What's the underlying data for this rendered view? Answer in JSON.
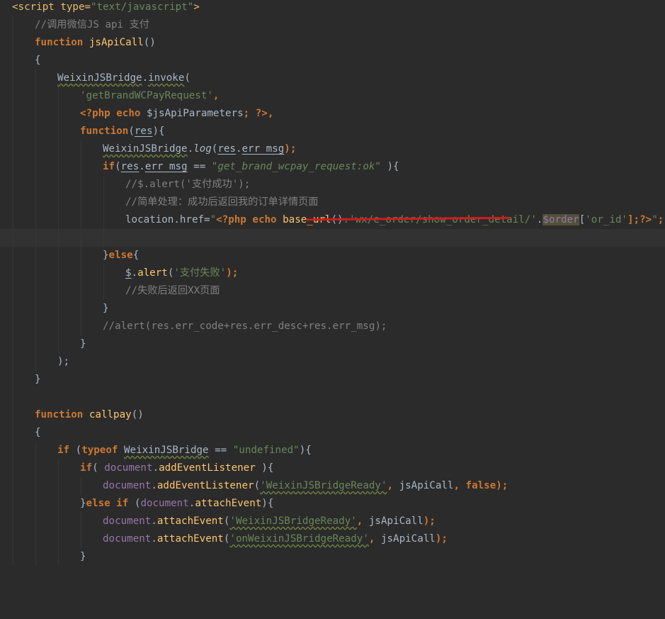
{
  "code": {
    "l01": {
      "open_tag": "<script type=",
      "type_val": "\"text/javascript\"",
      "close": ">"
    },
    "l02": {
      "comment": "//调用微信JS api 支付"
    },
    "l03": {
      "kw": "function",
      "name": "jsApiCall",
      "rest": "()"
    },
    "l04": {
      "text": "{"
    },
    "l05": {
      "obj": "WeixinJSBridge",
      "dot": ".",
      "method": "invoke",
      "rest": "("
    },
    "l06": {
      "str": "'getBrandWCPayRequest'",
      "rest": ","
    },
    "l07": {
      "php_open": "<?php",
      "echo": " echo ",
      "var": "$jsApiParameters",
      "semi": "; ",
      "php_close": "?>",
      "rest": ","
    },
    "l08": {
      "kw": "function",
      "param": "res",
      "rest": "){"
    },
    "l09": {
      "obj": "WeixinJSBridge",
      "dot": ".",
      "method": "log",
      "p1": "res",
      "p2": ".",
      "p3": "err_msg",
      "rest": ");"
    },
    "l10": {
      "kw": "if",
      "p1": "(",
      "res": "res",
      "dot": ".",
      "prop": "err_msg",
      "op": " == ",
      "str": "\"get_brand_wcpay_request:ok\"",
      "rest": " ){"
    },
    "l11": {
      "comment": "//$.alert('支付成功');"
    },
    "l12": {
      "comment": "//简单处理：成功后返回我的订单详情页面"
    },
    "l13": {
      "pre": "location.href=",
      "q": "\"",
      "php_open": "<?php",
      "echo": " echo ",
      "fn": "base_url",
      "paren": "()",
      "path": ".'wx/e_order/show_order_detail/'",
      "dot": ".",
      "var": "$order",
      "idx_o": "[",
      "idx": "'or_id'",
      "idx_c": "];",
      "php_close": "?>",
      "q2": "\"",
      "end": ";"
    },
    "l14": {
      "text": ""
    },
    "l15": {
      "brace": "}",
      "kw": "else",
      "rest": "{"
    },
    "l16": {
      "dollar": "$",
      "dot": ".",
      "method": "alert",
      "p": "(",
      "str": "'支付失败'",
      "rest": ");"
    },
    "l17": {
      "comment": "//失败后返回XX页面"
    },
    "l18": {
      "text": "}"
    },
    "l19": {
      "comment": "//alert(res.err_code+res.err_desc+res.err_msg);"
    },
    "l20": {
      "text": "}"
    },
    "l21": {
      "text": ");"
    },
    "l22": {
      "text": "}"
    },
    "l23": {
      "text": ""
    },
    "l24": {
      "kw": "function",
      "name": "callpay",
      "rest": "()"
    },
    "l25": {
      "text": "{"
    },
    "l26": {
      "kw": "if",
      "p": " (",
      "kw2": "typeof",
      "sp": " ",
      "obj": "WeixinJSBridge",
      "op": " == ",
      "str": "\"undefined\"",
      "rest": "){"
    },
    "l27": {
      "kw": "if",
      "p": "( ",
      "obj": "document",
      "dot": ".",
      "method": "addEventListener",
      "rest": " ){"
    },
    "l28": {
      "obj": "document",
      "dot": ".",
      "method": "addEventListener",
      "p": "(",
      "str": "'WeixinJSBridgeReady'",
      "comma": ", ",
      "arg": "jsApiCall",
      "comma2": ", ",
      "kw": "false",
      "rest": ");"
    },
    "l29": {
      "brace": "}",
      "kw": "else if",
      "p": " (",
      "obj": "document",
      "dot": ".",
      "method": "attachEvent",
      "rest": "){"
    },
    "l30": {
      "obj": "document",
      "dot": ".",
      "method": "attachEvent",
      "p": "(",
      "str": "'WeixinJSBridgeReady'",
      "comma": ", ",
      "arg": "jsApiCall",
      "rest": ");"
    },
    "l31": {
      "obj": "document",
      "dot": ".",
      "method": "attachEvent",
      "p": "(",
      "str": "'onWeixinJSBridgeReady'",
      "comma": ", ",
      "arg": "jsApiCall",
      "rest": ");"
    },
    "l32": {
      "text": "}"
    }
  },
  "colors": {
    "background": "#2b2b2b",
    "keyword": "#cc7832",
    "string": "#6a8759",
    "comment": "#808080",
    "function_name": "#ffc66d",
    "php_variable": "#9876aa",
    "annotation_line": "#d21b1b"
  }
}
